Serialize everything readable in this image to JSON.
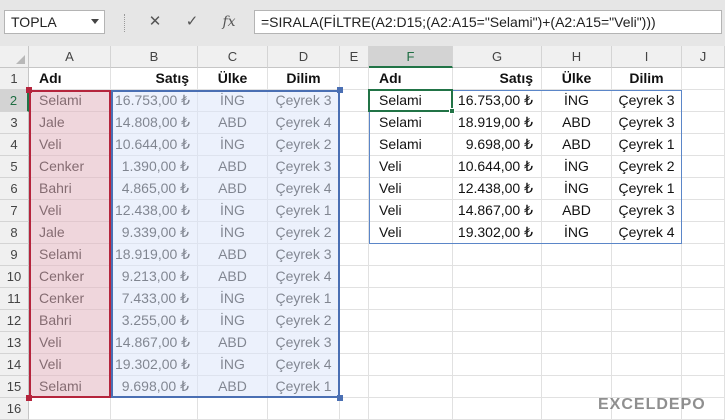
{
  "formula_bar": {
    "name_box": "TOPLA",
    "cancel_icon": "✕",
    "enter_icon": "✓",
    "function_icon": "fx",
    "formula": "=SIRALA(FİLTRE(A2:D15;(A2:A15=\"Selami\")+(A2:A15=\"Veli\")))"
  },
  "columns": [
    "A",
    "B",
    "C",
    "D",
    "E",
    "F",
    "G",
    "H",
    "I",
    "J"
  ],
  "rows": [
    "1",
    "2",
    "3",
    "4",
    "5",
    "6",
    "7",
    "8",
    "9",
    "10",
    "11",
    "12",
    "13",
    "14",
    "15",
    "16"
  ],
  "source_table": {
    "headers": [
      "Adı",
      "Satış",
      "Ülke",
      "Dilim"
    ],
    "rows": [
      [
        "Selami",
        "16.753,00 ₺",
        "İNG",
        "Çeyrek 3"
      ],
      [
        "Jale",
        "14.808,00 ₺",
        "ABD",
        "Çeyrek 4"
      ],
      [
        "Veli",
        "10.644,00 ₺",
        "İNG",
        "Çeyrek 2"
      ],
      [
        "Cenker",
        "1.390,00 ₺",
        "ABD",
        "Çeyrek 3"
      ],
      [
        "Bahri",
        "4.865,00 ₺",
        "ABD",
        "Çeyrek 4"
      ],
      [
        "Veli",
        "12.438,00 ₺",
        "İNG",
        "Çeyrek 1"
      ],
      [
        "Jale",
        "9.339,00 ₺",
        "İNG",
        "Çeyrek 2"
      ],
      [
        "Selami",
        "18.919,00 ₺",
        "ABD",
        "Çeyrek 3"
      ],
      [
        "Cenker",
        "9.213,00 ₺",
        "ABD",
        "Çeyrek 4"
      ],
      [
        "Cenker",
        "7.433,00 ₺",
        "İNG",
        "Çeyrek 1"
      ],
      [
        "Bahri",
        "3.255,00 ₺",
        "İNG",
        "Çeyrek 2"
      ],
      [
        "Veli",
        "14.867,00 ₺",
        "ABD",
        "Çeyrek 3"
      ],
      [
        "Veli",
        "19.302,00 ₺",
        "İNG",
        "Çeyrek 4"
      ],
      [
        "Selami",
        "9.698,00 ₺",
        "ABD",
        "Çeyrek 1"
      ]
    ]
  },
  "result_table": {
    "headers": [
      "Adı",
      "Satış",
      "Ülke",
      "Dilim"
    ],
    "rows": [
      [
        "Selami",
        "16.753,00 ₺",
        "İNG",
        "Çeyrek 3"
      ],
      [
        "Selami",
        "18.919,00 ₺",
        "ABD",
        "Çeyrek 3"
      ],
      [
        "Selami",
        "9.698,00 ₺",
        "ABD",
        "Çeyrek 1"
      ],
      [
        "Veli",
        "10.644,00 ₺",
        "İNG",
        "Çeyrek 2"
      ],
      [
        "Veli",
        "12.438,00 ₺",
        "İNG",
        "Çeyrek 1"
      ],
      [
        "Veli",
        "14.867,00 ₺",
        "ABD",
        "Çeyrek 3"
      ],
      [
        "Veli",
        "19.302,00 ₺",
        "İNG",
        "Çeyrek 4"
      ]
    ]
  },
  "watermark": "EXCELDEPO",
  "colors": {
    "selection_green": "#217346",
    "range_red": "#b5243c",
    "range_blue": "#4a6fb3"
  }
}
